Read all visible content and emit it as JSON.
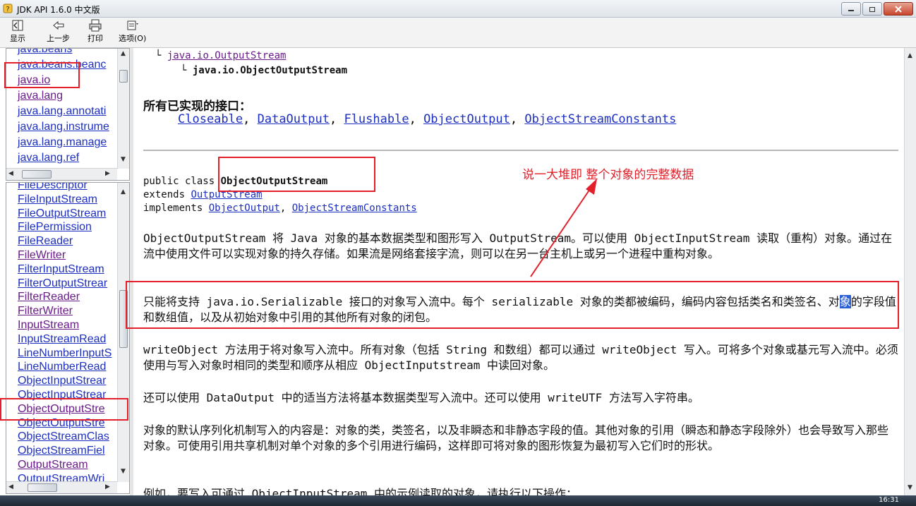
{
  "window": {
    "title": "JDK API 1.6.0 中文版"
  },
  "toolbar": {
    "buttons": [
      {
        "label": "显示",
        "icon": "show-pane-icon"
      },
      {
        "label": "上一步",
        "icon": "back-arrow-icon"
      },
      {
        "label": "打印",
        "icon": "printer-icon"
      },
      {
        "label": "选项(O)",
        "icon": "options-icon"
      }
    ]
  },
  "packages": [
    "java.beans",
    "java.beans.beanc",
    "java.io",
    "java.lang",
    "java.lang.annotati",
    "java.lang.instrume",
    "java.lang.manage",
    "java.lang.ref"
  ],
  "classes": [
    "FileDescriptor",
    "FileInputStream",
    "FileOutputStream",
    "FilePermission",
    "FileReader",
    "FileWriter",
    "FilterInputStream",
    "FilterOutputStrear",
    "FilterReader",
    "FilterWriter",
    "InputStream",
    "InputStreamRead",
    "LineNumberInputS",
    "LineNumberRead",
    "ObjectInputStrear",
    "ObjectInputStrear",
    "ObjectOutputStre",
    "ObjectOutputStre",
    "ObjectStreamClas",
    "ObjectStreamFiel",
    "OutputStream",
    "OutputStreamWri"
  ],
  "doc": {
    "hierarchy_parent": "java.io.OutputStream",
    "hierarchy_child": "java.io.ObjectOutputStream",
    "interfaces_heading": "所有已实现的接口：",
    "interfaces": [
      "Closeable",
      "DataOutput",
      "Flushable",
      "ObjectOutput",
      "ObjectStreamConstants"
    ],
    "decl_prefix": "public class ",
    "decl_class": "ObjectOutputStream",
    "extends_kw": "extends ",
    "extends_name": "OutputStream",
    "implements_kw": "implements ",
    "implements_1": "ObjectOutput",
    "implements_2": "ObjectStreamConstants",
    "para1": "ObjectOutputStream 将 Java 对象的基本数据类型和图形写入 OutputStream。可以使用 ObjectInputStream 读取（重构）对象。通过在流中使用文件可以实现对象的持久存储。如果流是网络套接字流，则可以在另一台主机上或另一个进程中重构对象。",
    "para2_a": "只能将支持 java.io.Serializable 接口的对象写入流中。每个 serializable 对象的类都被编码，编码内容包括类名和类签名、对",
    "para2_sel": "象",
    "para2_b": "的字段值和数组值，以及从初始对象中引用的其他所有对象的闭包。",
    "para3": "writeObject 方法用于将对象写入流中。所有对象（包括 String 和数组）都可以通过 writeObject 写入。可将多个对象或基元写入流中。必须使用与写入对象时相同的类型和顺序从相应 ObjectInputstream 中读回对象。",
    "para4": "还可以使用 DataOutput 中的适当方法将基本数据类型写入流中。还可以使用 writeUTF 方法写入字符串。",
    "para5": "对象的默认序列化机制写入的内容是：对象的类，类签名，以及非瞬态和非静态字段的值。其他对象的引用（瞬态和静态字段除外）也会导致写入那些对象。可使用引用共享机制对单个对象的多个引用进行编码，这样即可将对象的图形恢复为最初写入它们时的形状。",
    "para6": "例如，要写入可通过 ObjectInputStream 中的示例读取的对象，请执行以下操作："
  },
  "annotation": {
    "text": "说一大堆即 整个对象的完整数据"
  },
  "taskbar": {
    "clock": "16:31"
  },
  "colors": {
    "annotation_red": "#e3202a",
    "link_blue": "#1d2fbf",
    "visited_purple": "#6a1b8a",
    "selection": "#2b5fd6"
  }
}
